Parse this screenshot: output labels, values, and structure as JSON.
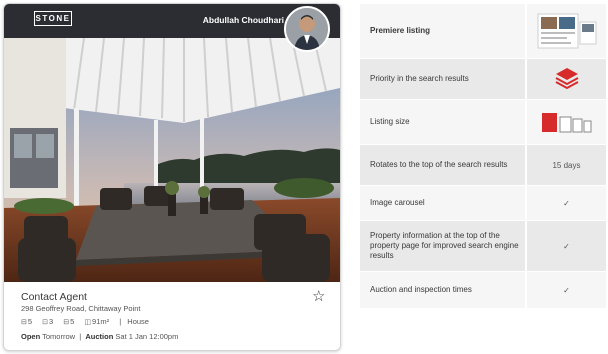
{
  "card": {
    "logo_text": "STONE",
    "agent_name": "Abdullah Choudhari",
    "title": "Contact Agent",
    "address": "298 Geoffrey Road, Chittaway Point",
    "features": {
      "beds": "5",
      "baths": "3",
      "cars": "5",
      "land": "91m²",
      "type": "House"
    },
    "open_label": "Open",
    "open_value": "Tomorrow",
    "auction_label": "Auction",
    "auction_value": "Sat 1 Jan 12:00pm"
  },
  "features_table": {
    "rows": [
      {
        "label": "Premiere listing",
        "value": ""
      },
      {
        "label": "Priority in the search results",
        "value": ""
      },
      {
        "label": "Listing size",
        "value": ""
      },
      {
        "label": "Rotates to the top of the search results",
        "value": "15 days"
      },
      {
        "label": "Image carousel",
        "value": "✓"
      },
      {
        "label": "Property information at the top of the property page for improved search engine results",
        "value": "✓"
      },
      {
        "label": "Auction and inspection times",
        "value": "✓"
      }
    ]
  },
  "colors": {
    "header_bg": "#2b2d33",
    "accent_red": "#d72b2b",
    "table_bg": "#f2f2f2"
  }
}
